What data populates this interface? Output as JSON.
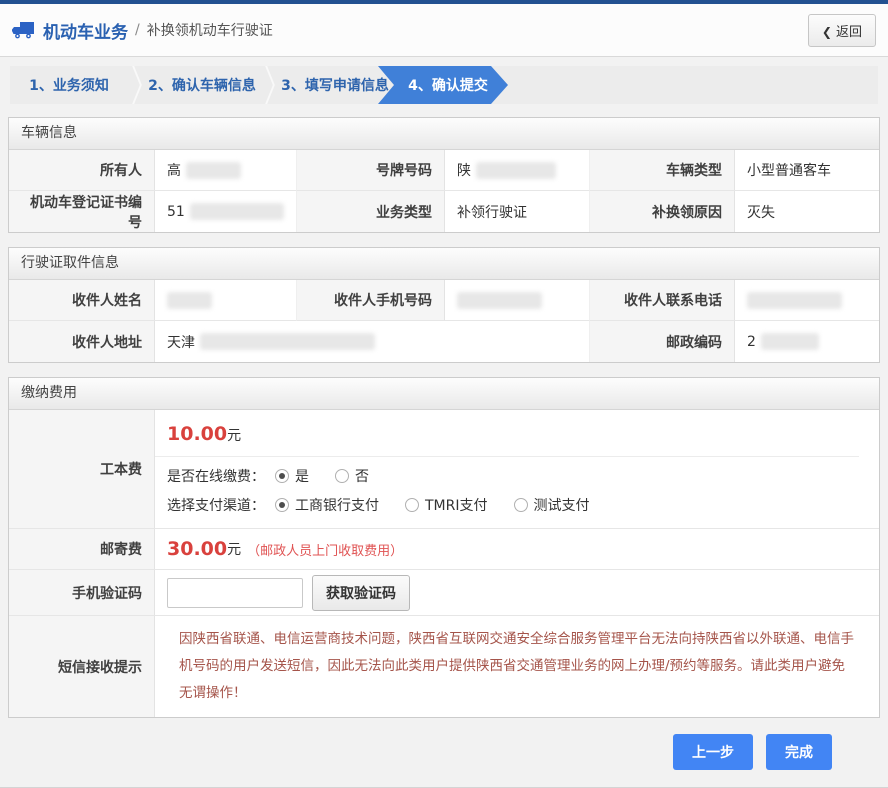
{
  "header": {
    "app_title": "机动车业务",
    "separator": "/",
    "page_title": "补换领机动车行驶证",
    "back_chevron": "❮",
    "back_label": "返回"
  },
  "steps": [
    {
      "label": "1、业务须知",
      "active": false
    },
    {
      "label": "2、确认车辆信息",
      "active": false
    },
    {
      "label": "3、填写申请信息",
      "active": false
    },
    {
      "label": "4、确认提交",
      "active": true
    }
  ],
  "vehicle_info": {
    "title": "车辆信息",
    "owner_label": "所有人",
    "owner_value": "高",
    "plate_label": "号牌号码",
    "plate_value": "陕",
    "vehicle_type_label": "车辆类型",
    "vehicle_type_value": "小型普通客车",
    "registration_no_label": "机动车登记证书编号",
    "registration_no_value": "51",
    "business_type_label": "业务类型",
    "business_type_value": "补领行驶证",
    "reason_label": "补换领原因",
    "reason_value": "灭失"
  },
  "pickup_info": {
    "title": "行驶证取件信息",
    "recipient_name_label": "收件人姓名",
    "recipient_phone_label": "收件人手机号码",
    "recipient_tel_label": "收件人联系电话",
    "recipient_address_label": "收件人地址",
    "recipient_address_value": "天津",
    "postal_code_label": "邮政编码",
    "postal_code_value": "2"
  },
  "payment": {
    "title": "缴纳费用",
    "cost_label": "工本费",
    "cost_amount": "10.00",
    "cost_unit": "元",
    "online_pay_label": "是否在线缴费：",
    "online_pay_options": [
      {
        "label": "是",
        "checked": true
      },
      {
        "label": "否",
        "checked": false
      }
    ],
    "channel_label": "选择支付渠道：",
    "channel_options": [
      {
        "label": "工商银行支付",
        "checked": true
      },
      {
        "label": "TMRI支付",
        "checked": false
      },
      {
        "label": "测试支付",
        "checked": false
      }
    ],
    "postage_label": "邮寄费",
    "postage_amount": "30.00",
    "postage_unit": "元",
    "postage_note": "（邮政人员上门收取费用）",
    "sms_code_label": "手机验证码",
    "sms_code_value": "",
    "get_code_button": "获取验证码",
    "sms_tip_label": "短信接收提示",
    "sms_tip_text": "因陕西省联通、电信运营商技术问题，陕西省互联网交通安全综合服务管理平台无法向持陕西省以外联通、电信手机号码的用户发送短信，因此无法向此类用户提供陕西省交通管理业务的网上办理/预约等服务。请此类用户避免无谓操作！"
  },
  "footer": {
    "prev_button": "上一步",
    "finish_button": "完成"
  },
  "colors": {
    "topbar": "#235191",
    "accent_blue": "#4080d8",
    "button_blue": "#4285f4",
    "price_red": "#d9413d",
    "warning_text": "#a5544a"
  }
}
